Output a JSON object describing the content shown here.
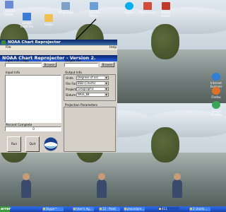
{
  "desktop": {
    "icons": [
      {
        "label": "Crimson Editor",
        "color": "#6a8bd6"
      },
      {
        "label": "Google Earth Pro",
        "color": "#3a7bd5"
      },
      {
        "label": "HP ScanJet",
        "color": "#7fa1c8"
      },
      {
        "label": "OpenGL Demo",
        "color": "#6c9ed6"
      },
      {
        "label": "Skype",
        "color": "#00aff0"
      },
      {
        "label": "PDF Creator",
        "color": "#d24c3c"
      },
      {
        "label": "Adobe Reader",
        "color": "#c0392b"
      },
      {
        "label": "Folder",
        "color": "#f0c050"
      },
      {
        "label": "Internet Explorer",
        "color": "#2f7fd6"
      },
      {
        "label": "Firefox",
        "color": "#e0702a"
      },
      {
        "label": "Google Chrome",
        "color": "#3aa757"
      }
    ]
  },
  "outer_window": {
    "title": "NOAA Chart Reprojector",
    "menu_file": "File",
    "menu_help": "Help"
  },
  "app": {
    "title": "NOAA Chart Reprojector - Version 2.",
    "input_file_label": "Input File (.kap)",
    "output_file_label": "Output File",
    "browse": "Browse",
    "input_info_label": "Input Info",
    "output_info_label": "Output Info",
    "units_label": "Units",
    "units_value": "Degrees of arc",
    "format_label": "File Format",
    "format_value": "BSB (Charts)",
    "projection_label": "Projection",
    "projection_value": "Geographic",
    "datum_label": "Datum",
    "datum_value": "WGS_84",
    "params_label": "Projection Parameters",
    "percent_label": "Percent Complete",
    "percent_value": "0",
    "run": "Run",
    "quit": "Quit"
  },
  "taskbar": {
    "start": "arrer",
    "tasks": [
      "Skype™ -",
      "User's Ag...",
      "12 - Paint",
      "procedure...",
      "411",
      "2 charts..."
    ]
  },
  "colors": {
    "title_bar": "#0a246a",
    "window_bg": "#d4d0c8",
    "taskbar": "#245edb"
  }
}
